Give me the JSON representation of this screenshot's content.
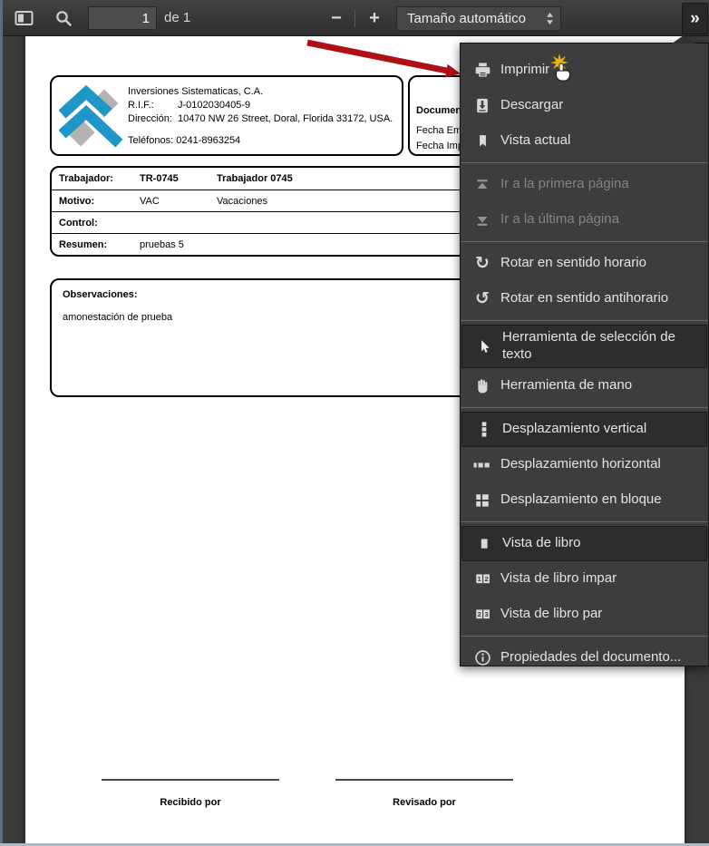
{
  "toolbar": {
    "page_input_value": "1",
    "page_count_label": "de 1",
    "zoom_out_glyph": "−",
    "zoom_in_glyph": "+",
    "scale_select_value": "Tamaño automático",
    "overflow_glyph": "»"
  },
  "menu": {
    "items": [
      {
        "id": "print",
        "icon": "printer-icon",
        "label": "Imprimir"
      },
      {
        "id": "download",
        "icon": "download-icon",
        "label": "Descargar"
      },
      {
        "id": "current-view",
        "icon": "bookmark-icon",
        "label": "Vista actual"
      },
      {
        "type": "separator"
      },
      {
        "id": "first-page",
        "icon": "first-page-icon",
        "label": "Ir a la primera página",
        "disabled": true
      },
      {
        "id": "last-page",
        "icon": "last-page-icon",
        "label": "Ir a la última página",
        "disabled": true
      },
      {
        "type": "separator"
      },
      {
        "id": "rotate-cw",
        "icon": "rotate-cw-icon",
        "label": "Rotar en sentido horario"
      },
      {
        "id": "rotate-ccw",
        "icon": "rotate-ccw-icon",
        "label": "Rotar en sentido antihorario"
      },
      {
        "type": "separator"
      },
      {
        "id": "text-selection-tool",
        "icon": "cursor-icon",
        "label": "Herramienta de selección de texto",
        "toggled": true,
        "two_line": true
      },
      {
        "id": "hand-tool",
        "icon": "hand-icon",
        "label": "Herramienta de mano"
      },
      {
        "type": "separator"
      },
      {
        "id": "scroll-vertical",
        "icon": "scroll-vertical-icon",
        "label": "Desplazamiento vertical",
        "toggled": true
      },
      {
        "id": "scroll-horizontal",
        "icon": "scroll-horizontal-icon",
        "label": "Desplazamiento horizontal"
      },
      {
        "id": "scroll-wrapped",
        "icon": "scroll-wrapped-icon",
        "label": "Desplazamiento en bloque"
      },
      {
        "type": "separator"
      },
      {
        "id": "book-view",
        "icon": "book-view-icon",
        "label": "Vista de libro",
        "toggled": true
      },
      {
        "id": "book-view-odd",
        "icon": "odd-spread-icon",
        "label": "Vista de libro impar"
      },
      {
        "id": "book-view-even",
        "icon": "even-spread-icon",
        "label": "Vista de libro par"
      },
      {
        "type": "separator"
      },
      {
        "id": "document-properties",
        "icon": "info-icon",
        "label": "Propiedades del documento..."
      }
    ]
  },
  "document": {
    "company": {
      "name": "Inversiones Sistematicas, C.A.",
      "rif_label": "R.I.F.:",
      "rif_value": "J-0102030405-9",
      "address_label": "Dirección:",
      "address_value": "10470 NW 26 Street, Doral, Florida 33172, USA.",
      "phones_label": "Teléfonos:",
      "phones_value": "0241-8963254"
    },
    "doc_info": {
      "title_visible": "Documento:",
      "line1_visible": "Fecha Emisión:",
      "line2_visible": "Fecha Impresión:"
    },
    "table": {
      "rows": [
        {
          "label": "Trabajador:",
          "col1": "TR-0745",
          "col2": "Trabajador 0745",
          "bold": true
        },
        {
          "label": "Motivo:",
          "col1": "VAC",
          "col2": "Vacaciones",
          "bold": false
        },
        {
          "label": "Control:",
          "col1": "",
          "col2": "",
          "bold": false
        },
        {
          "label": "Resumen:",
          "col1": "pruebas 5",
          "col2": "",
          "bold": false
        }
      ]
    },
    "observations": {
      "label": "Observaciones:",
      "text": "amonestación de prueba"
    },
    "signatures": [
      {
        "label": "Recibido por"
      },
      {
        "label": "Revisado por"
      }
    ]
  },
  "colors": {
    "annotation_arrow": "#ae1015",
    "click_star": "#e8b410",
    "logo_blue": "#1e96c8",
    "logo_gray": "#b3b3b3"
  }
}
